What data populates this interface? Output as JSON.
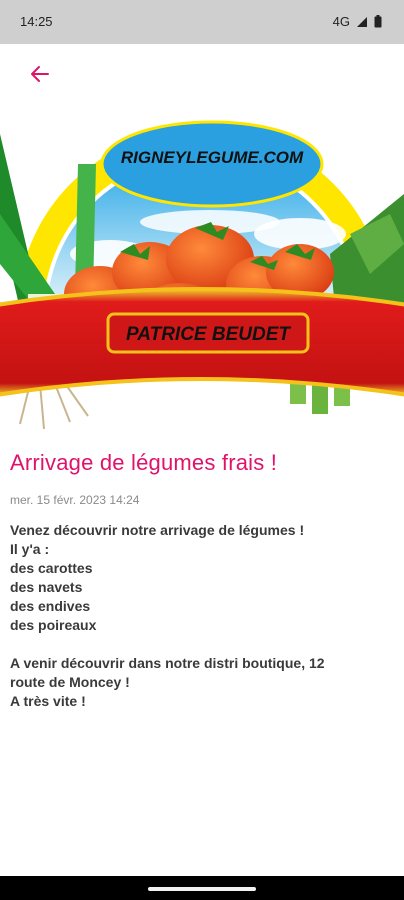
{
  "status_bar": {
    "time": "14:25",
    "network": "4G",
    "icons": [
      "signal-icon",
      "battery-icon"
    ]
  },
  "header": {
    "back_icon": "arrow-left-icon",
    "logo_text_website": "RIGNEYLEGUME.COM",
    "logo_text_name": "PATRICE BEUDET"
  },
  "post": {
    "title": "Arrivage de légumes frais !",
    "date": "mer. 15 févr. 2023 14:24",
    "body_lines": [
      "Venez découvrir notre arrivage de légumes !",
      "Il y'a :",
      "des carottes",
      "des navets",
      "des endives",
      "des poireaux",
      "",
      "A venir découvrir dans notre distri boutique, 12",
      "route de Moncey !",
      "A très vite !"
    ]
  },
  "colors": {
    "accent": "#e0136b",
    "status_bar": "#cfcfcf",
    "banner_red": "#d21a1a",
    "banner_gold": "#f4c21a",
    "sun_yellow": "#ffe600"
  }
}
